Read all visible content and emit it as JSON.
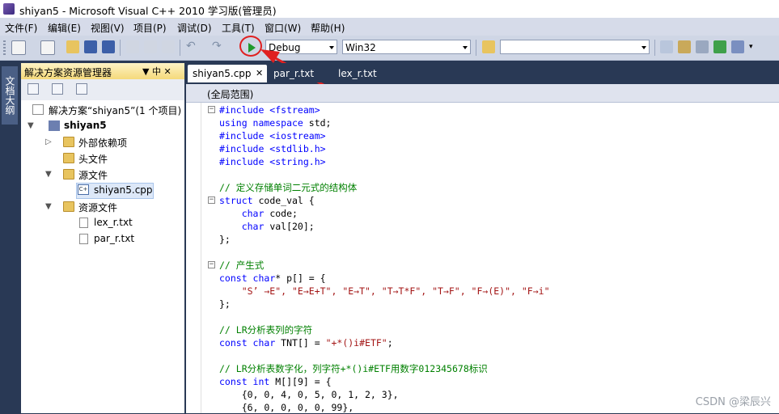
{
  "window": {
    "title": "shiyan5 - Microsoft Visual C++ 2010 学习版(管理员)"
  },
  "menu": [
    "文件(F)",
    "编辑(E)",
    "视图(V)",
    "项目(P)",
    "调试(D)",
    "工具(T)",
    "窗口(W)",
    "帮助(H)"
  ],
  "toolbar": {
    "config": "Debug",
    "platform": "Win32",
    "find_value": ""
  },
  "left_strip": {
    "tab": "文档大纲"
  },
  "solution_explorer": {
    "title": "解决方案资源管理器",
    "pin": "▼ 中 ✕",
    "tree": {
      "solution": "解决方案“shiyan5”(1 个项目)",
      "project": "shiyan5",
      "external": "外部依赖项",
      "headers": "头文件",
      "sources": "源文件",
      "source_file": "shiyan5.cpp",
      "resources": "资源文件",
      "res_file_1": "lex_r.txt",
      "res_file_2": "par_r.txt"
    }
  },
  "tabs": [
    "shiyan5.cpp",
    "par_r.txt",
    "lex_r.txt"
  ],
  "tab_close": "✕",
  "scope": "(全局范围)",
  "code": {
    "l1": "#include <fstream>",
    "l2a": "using namespace",
    "l2b": " std;",
    "l3": "#include <iostream>",
    "l4": "#include <stdlib.h>",
    "l5": "#include <string.h>",
    "l7": "// 定义存储单词二元式的结构体",
    "l8a": "struct",
    "l8b": " code_val {",
    "l9a": "    char",
    "l9b": " code;",
    "l10a": "    char",
    "l10b": " val[20];",
    "l11": "};",
    "l13": "// 产生式",
    "l14a": "const",
    "l14b": " char",
    "l14c": "* p[] = {",
    "l15": "    \"S’ →E\", \"E→E+T\", \"E→T\", \"T→T*F\", \"T→F\", \"F→(E)\", \"F→i\"",
    "l16": "};",
    "l18": "// LR分析表列的字符",
    "l19a": "const",
    "l19b": " char",
    "l19c": " TNT[] = ",
    "l19d": "\"+*()i#ETF\"",
    "l19e": ";",
    "l21": "// LR分析表数字化，列字符+*()i#ETF用数字012345678标识",
    "l22a": "const",
    "l22b": " int",
    "l22c": " M[][9] = {",
    "l23": "    {0, 0, 4, 0, 5, 0, 1, 2, 3},",
    "l24": "    {6, 0, 0, 0, 0, 99},"
  },
  "watermark": "CSDN @梁辰兴",
  "colors": {
    "titlebar": "#ffffff",
    "chrome": "#293955",
    "keyword": "#0000ff",
    "string": "#a31515",
    "comment": "#008000",
    "annotation": "#e02020"
  }
}
